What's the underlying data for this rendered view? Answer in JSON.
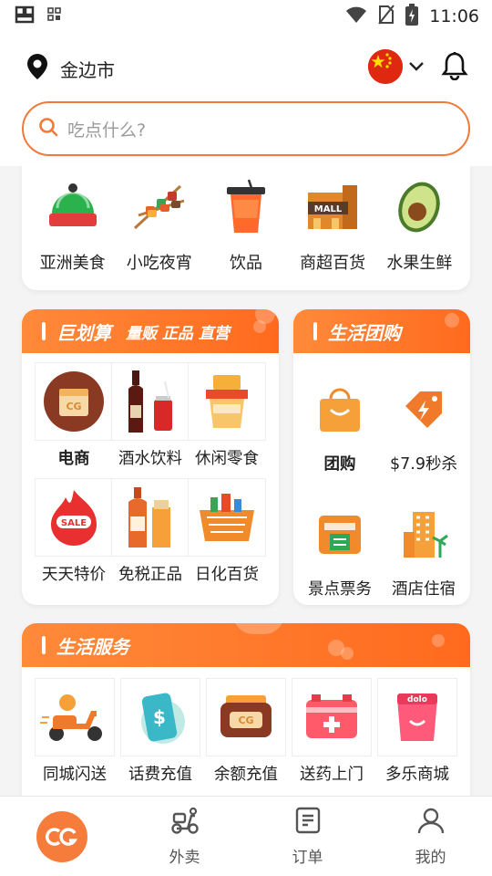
{
  "status_bar": {
    "time": "11:06"
  },
  "header": {
    "location": "金边市",
    "search_placeholder": "吃点什么?"
  },
  "categories": [
    {
      "label": "亚洲美食",
      "icon": "asian-food-icon"
    },
    {
      "label": "小吃夜宵",
      "icon": "skewers-icon"
    },
    {
      "label": "饮品",
      "icon": "drink-icon"
    },
    {
      "label": "商超百货",
      "icon": "mall-icon"
    },
    {
      "label": "水果生鲜",
      "icon": "avocado-icon"
    }
  ],
  "deals": {
    "title": "巨划算",
    "subtitle": "量贩 正品 直营",
    "items": [
      {
        "label": "电商",
        "icon": "ecommerce-box-icon"
      },
      {
        "label": "酒水饮料",
        "icon": "wine-bottle-icon"
      },
      {
        "label": "休闲零食",
        "icon": "snacks-icon"
      },
      {
        "label": "天天特价",
        "icon": "sale-tag-icon"
      },
      {
        "label": "免税正品",
        "icon": "duty-free-bottle-icon"
      },
      {
        "label": "日化百货",
        "icon": "basket-icon"
      }
    ]
  },
  "group": {
    "title": "生活团购",
    "items": [
      {
        "label": "团购",
        "icon": "shopping-bag-icon"
      },
      {
        "label": "$7.9秒杀",
        "icon": "flash-tag-icon"
      },
      {
        "label": "景点票务",
        "icon": "ticket-icon"
      },
      {
        "label": "酒店住宿",
        "icon": "hotel-icon"
      }
    ]
  },
  "services": {
    "title": "生活服务",
    "items": [
      {
        "label": "同城闪送",
        "icon": "scooter-icon"
      },
      {
        "label": "话费充值",
        "icon": "phone-topup-icon"
      },
      {
        "label": "余额充值",
        "icon": "wallet-icon"
      },
      {
        "label": "送药上门",
        "icon": "medicine-kit-icon"
      },
      {
        "label": "多乐商城",
        "icon": "dolo-mall-icon"
      }
    ]
  },
  "nav": [
    {
      "label": "",
      "icon": "home-logo-icon"
    },
    {
      "label": "外卖",
      "icon": "delivery-scooter-icon"
    },
    {
      "label": "订单",
      "icon": "order-list-icon"
    },
    {
      "label": "我的",
      "icon": "profile-icon"
    }
  ],
  "colors": {
    "accent": "#f57c3a",
    "header_gradient_start": "#ff8a3a",
    "header_gradient_end": "#ff6a1e"
  }
}
